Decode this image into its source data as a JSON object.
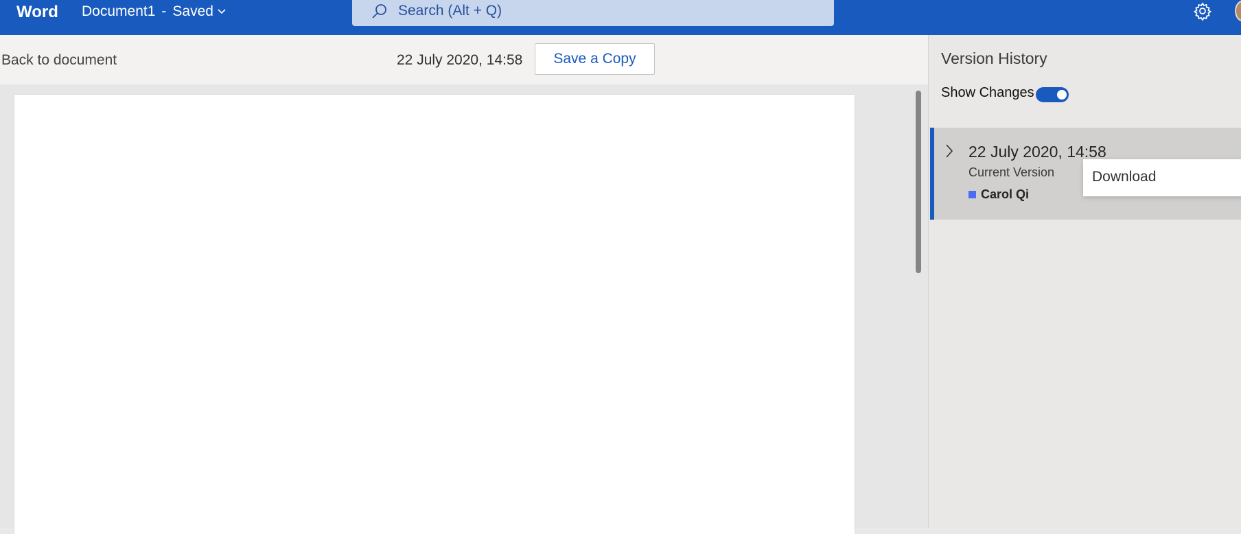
{
  "app": {
    "name": "Word"
  },
  "document": {
    "title": "Document1",
    "separator": "-",
    "status": "Saved"
  },
  "search": {
    "placeholder": "Search (Alt + Q)"
  },
  "toolbar": {
    "back_label": "Back to document",
    "version_date": "22 July 2020, 14:58",
    "save_copy_label": "Save a Copy"
  },
  "version_history": {
    "title": "Version History",
    "show_changes_label": "Show Changes",
    "show_changes_on": true,
    "versions": [
      {
        "date": "22 July 2020, 14:58",
        "label": "Current Version",
        "author": "Carol Qi",
        "author_color": "#4a6cf7"
      }
    ]
  },
  "context_menu": {
    "items": [
      "Download"
    ]
  },
  "colors": {
    "accent": "#185abd",
    "search_bg": "#c7d6ec",
    "pane_bg": "#eae8e6",
    "selected_item_bg": "#d2d0ce"
  },
  "icons": {
    "search": "search-icon",
    "gear": "gear-icon",
    "chevron": "chevron-down-icon",
    "expand": "chevron-right-icon"
  }
}
